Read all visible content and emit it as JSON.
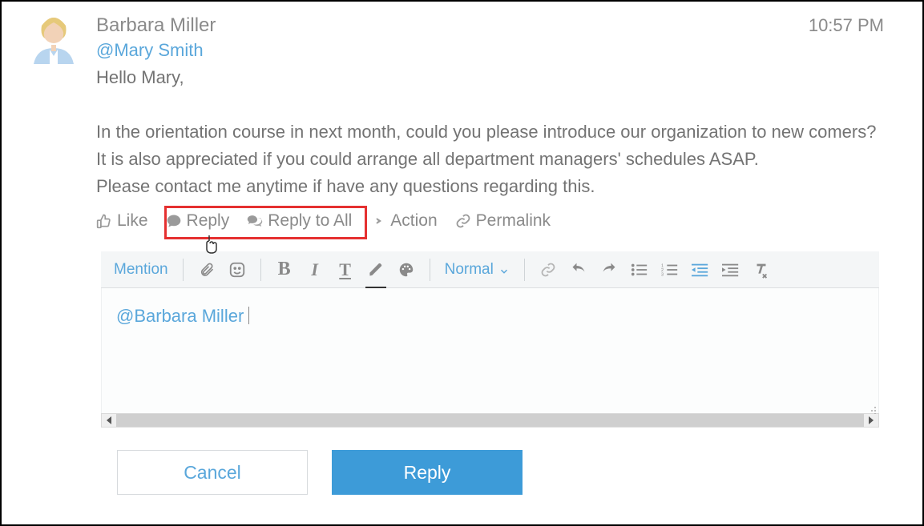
{
  "post": {
    "author": "Barbara Miller",
    "timestamp": "10:57 PM",
    "mention": "@Mary Smith",
    "greeting": "Hello Mary,",
    "body_line1": "In the orientation course in next month, could you please introduce our organization to new comers?",
    "body_line2": "It is also appreciated if you could arrange all department managers' schedules ASAP.",
    "body_line3": "Please contact me anytime if have any questions regarding this."
  },
  "actions": {
    "like": "Like",
    "reply": "Reply",
    "reply_all": "Reply to All",
    "action": "Action",
    "permalink": "Permalink"
  },
  "editor": {
    "mention_btn": "Mention",
    "style_dropdown": "Normal",
    "content_mention": "@Barbara Miller"
  },
  "buttons": {
    "cancel": "Cancel",
    "reply": "Reply"
  }
}
